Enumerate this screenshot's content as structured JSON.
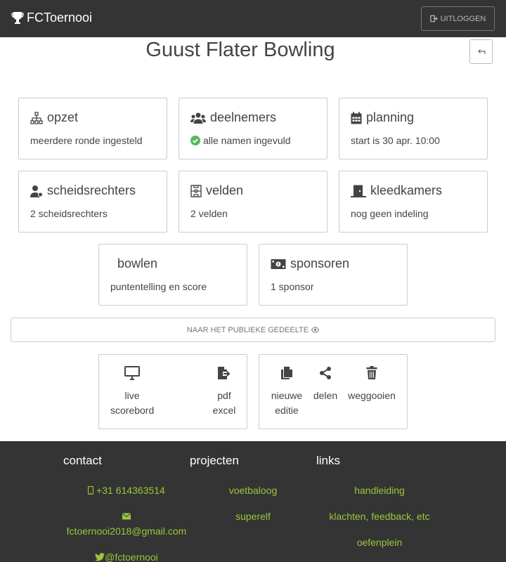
{
  "navbar": {
    "brand": "FCToernooi",
    "logout_label": "UITLOGGEN"
  },
  "page": {
    "title": "Guust Flater Bowling"
  },
  "cards": [
    {
      "id": "opzet",
      "title": "opzet",
      "subtitle": "meerdere ronde ingesteld",
      "icon": "sitemap-icon"
    },
    {
      "id": "deelnemers",
      "title": "deelnemers",
      "subtitle": "alle namen ingevuld",
      "icon": "users-icon",
      "sub_icon": "check-circle-icon"
    },
    {
      "id": "planning",
      "title": "planning",
      "subtitle": "start is 30 apr. 10:00",
      "icon": "calendar-icon"
    },
    {
      "id": "scheidsrechters",
      "title": "scheidsrechters",
      "subtitle": "2 scheidsrechters",
      "icon": "referee-icon"
    },
    {
      "id": "velden",
      "title": "velden",
      "subtitle": "2 velden",
      "icon": "field-icon"
    },
    {
      "id": "kleedkamers",
      "title": "kleedkamers",
      "subtitle": "nog geen indeling",
      "icon": "door-icon"
    },
    {
      "id": "bowlen",
      "title": "bowlen",
      "subtitle": "puntentelling en score",
      "icon": ""
    },
    {
      "id": "sponsoren",
      "title": "sponsoren",
      "subtitle": "1 sponsor",
      "icon": "money-icon"
    }
  ],
  "public_button": {
    "label": "NAAR HET PUBLIEKE GEDEELTE",
    "icon": "eye-icon"
  },
  "actions": {
    "live": {
      "line1": "live",
      "line2": "scorebord",
      "icon": "desktop-icon"
    },
    "export": {
      "line1": "pdf",
      "line2": "excel",
      "icon": "file-export-icon"
    },
    "new_edition": {
      "line1": "nieuwe",
      "line2": "editie",
      "icon": "copy-icon"
    },
    "share": {
      "line1": "delen",
      "icon": "share-icon"
    },
    "delete": {
      "line1": "weggooien",
      "icon": "trash-icon"
    }
  },
  "footer": {
    "contact": {
      "heading": "contact",
      "phone": "+31 614363514",
      "email": "fctoernooi2018@gmail.com",
      "twitter": "@fctoernooi"
    },
    "projects": {
      "heading": "projecten",
      "items": [
        "voetbaloog",
        "superelf"
      ]
    },
    "links": {
      "heading": "links",
      "items": [
        "handleiding",
        "klachten, feedback, etc",
        "oefenplein"
      ]
    }
  },
  "colors": {
    "navbar": "#343434",
    "footer_link": "#9ac73a",
    "check": "#5cb85c"
  }
}
